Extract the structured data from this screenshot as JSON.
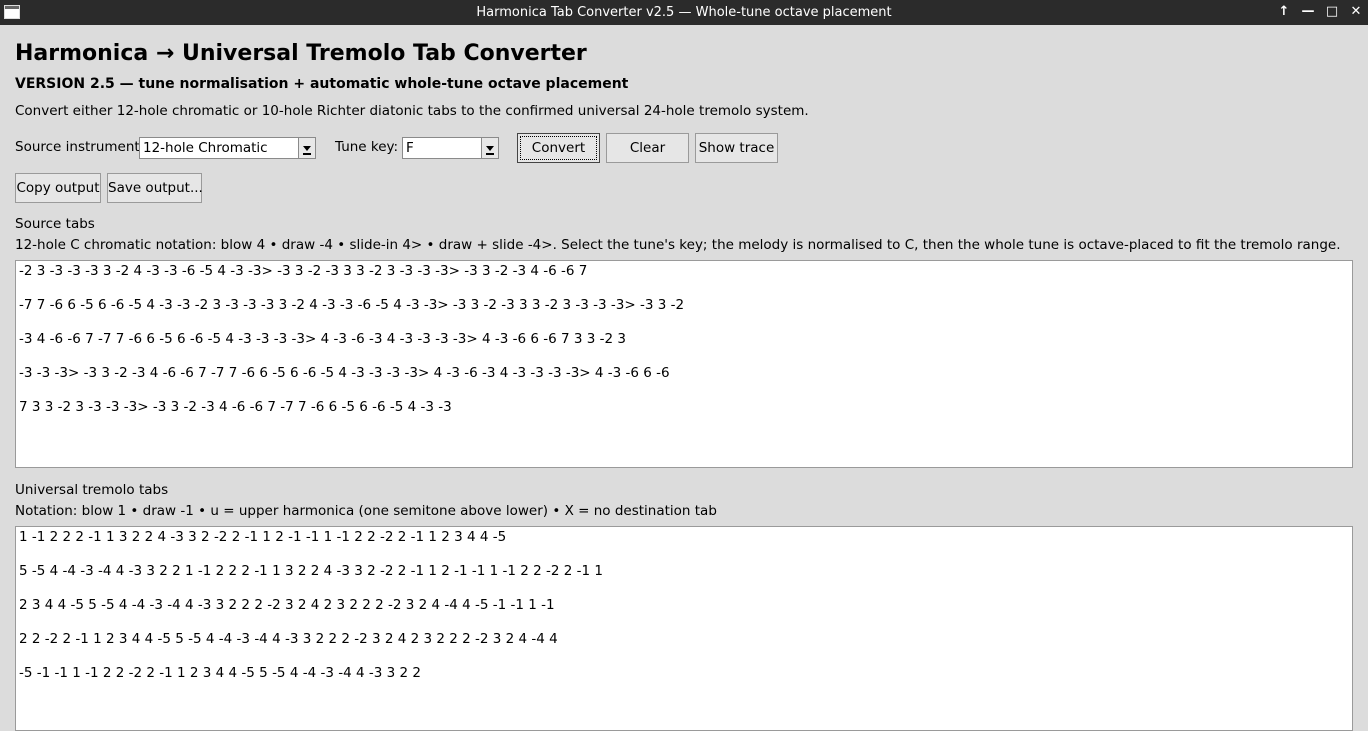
{
  "window": {
    "title": "Harmonica Tab Converter v2.5 — Whole-tune octave placement",
    "controls": [
      "↑",
      "—",
      "□",
      "✕"
    ]
  },
  "header": {
    "title": "Harmonica → Universal Tremolo Tab Converter",
    "version": "VERSION 2.5 — tune normalisation + automatic whole-tune octave placement",
    "description": "Convert either 12-hole chromatic or 10-hole Richter diatonic tabs to the confirmed universal 24-hole tremolo system."
  },
  "controls": {
    "source_label": "Source instrument:",
    "source_value": "12-hole Chromatic",
    "key_label": "Tune key:",
    "key_value": "F",
    "convert_label": "Convert",
    "clear_label": "Clear",
    "trace_label": "Show trace",
    "copy_label": "Copy output",
    "save_label": "Save output..."
  },
  "source": {
    "label": "Source tabs",
    "notation": "12-hole C chromatic notation: blow 4  •  draw -4  •  slide-in 4>  •  draw + slide -4>. Select the tune's key; the melody is normalised to C, then the whole tune is octave-placed to fit the tremolo range.",
    "lines": [
      "-2 3 -3 -3 -3 3 -2 4 -3 -3 -6 -5 4 -3 -3> -3 3 -2 -3 3 3 -2 3 -3 -3 -3> -3 3 -2 -3 4 -6 -6 7",
      "-7 7 -6 6 -5 6 -6 -5 4 -3 -3 -2 3 -3 -3 -3 3 -2 4 -3 -3 -6 -5 4 -3 -3> -3 3 -2 -3 3 3 -2 3 -3 -3 -3> -3 3 -2",
      "-3 4 -6 -6 7 -7 7 -6 6 -5 6 -6 -5 4 -3 -3 -3 -3> 4 -3 -6 -3 4 -3 -3 -3 -3> 4 -3 -6 6 -6 7 3 3 -2 3",
      "-3 -3 -3> -3 3 -2 -3 4 -6 -6 7 -7 7 -6 6 -5 6 -6 -5 4 -3 -3 -3 -3> 4 -3 -6 -3 4 -3 -3 -3 -3> 4 -3 -6 6 -6",
      "7 3 3 -2 3 -3 -3 -3> -3 3 -2 -3 4 -6 -6 7 -7 7 -6 6 -5 6 -6 -5 4 -3 -3"
    ]
  },
  "output": {
    "label": "Universal tremolo tabs",
    "notation": "Notation: blow 1  •  draw -1  •  u = upper harmonica (one semitone above lower)  •  X = no destination tab",
    "lines": [
      "1 -1 2 2 2 -1 1 3 2 2 4 -3 3 2 -2 2 -1 1 2 -1 -1 1 -1 2 2 -2 2 -1 1 2 3 4 4 -5",
      "5 -5 4 -4 -3 -4 4 -3 3 2 2 1 -1 2 2 2 -1 1 3 2 2 4 -3 3 2 -2 2 -1 1 2 -1 -1 1 -1 2 2 -2 2 -1 1",
      "2 3 4 4 -5 5 -5 4 -4 -3 -4 4 -3 3 2 2 2 -2 3 2 4 2 3 2 2 2 -2 3 2 4 -4 4 -5 -1 -1 1 -1",
      "2 2 -2 2 -1 1 2 3 4 4 -5 5 -5 4 -4 -3 -4 4 -3 3 2 2 2 -2 3 2 4 2 3 2 2 2 -2 3 2 4 -4 4",
      "-5 -1 -1 1 -1 2 2 -2 2 -1 1 2 3 4 4 -5 5 -5 4 -4 -3 -4 4 -3 3 2 2"
    ]
  }
}
